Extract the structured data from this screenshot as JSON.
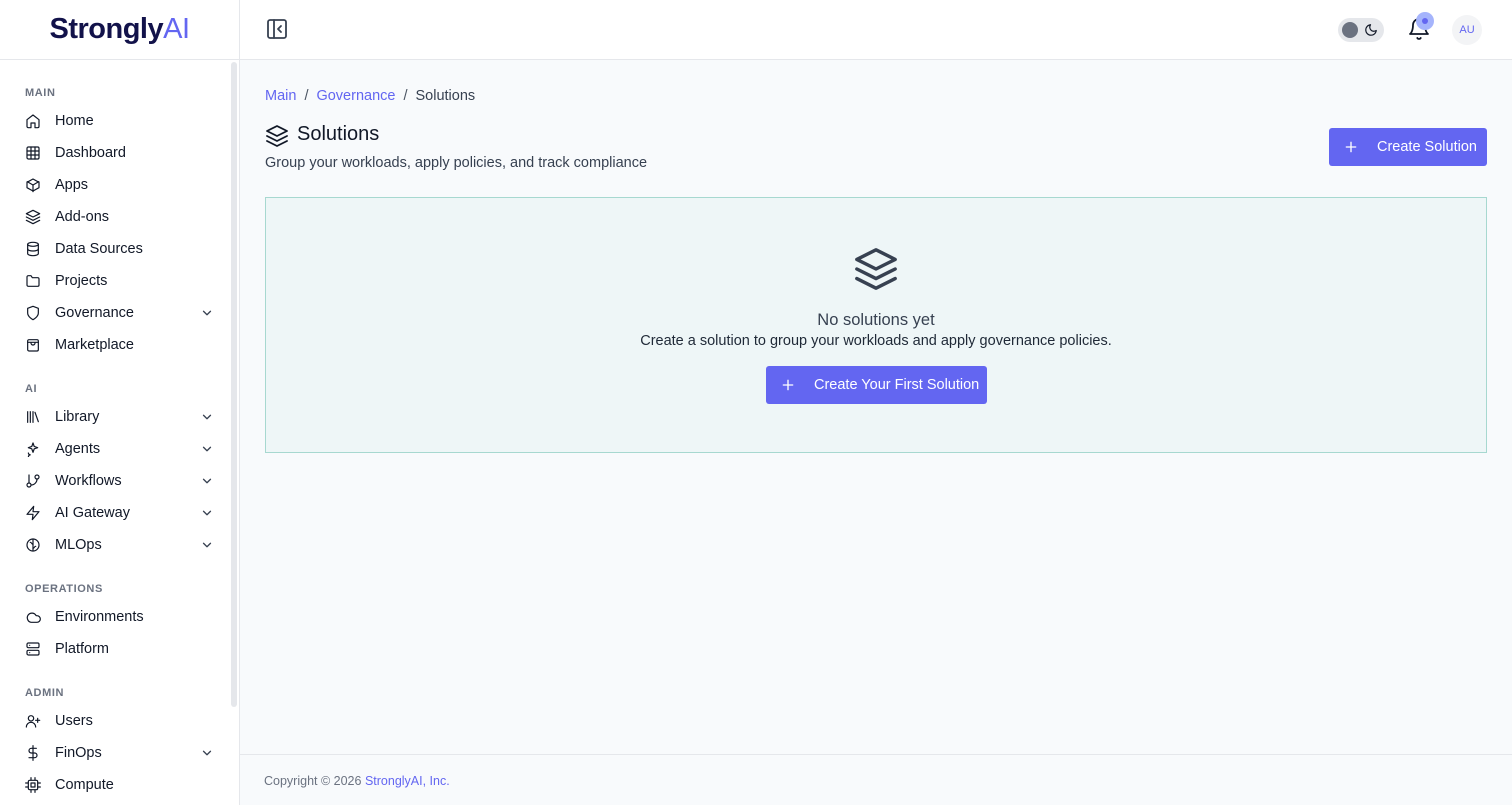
{
  "brand": {
    "name_bold": "Strongly",
    "name_light": "AI"
  },
  "sidebar": {
    "sections": [
      {
        "label": "MAIN",
        "items": [
          {
            "label": "Home",
            "icon": "home-icon",
            "chevron": false
          },
          {
            "label": "Dashboard",
            "icon": "grid-icon",
            "chevron": false
          },
          {
            "label": "Apps",
            "icon": "box-icon",
            "chevron": false
          },
          {
            "label": "Add-ons",
            "icon": "layers-icon",
            "chevron": false
          },
          {
            "label": "Data Sources",
            "icon": "database-icon",
            "chevron": false
          },
          {
            "label": "Projects",
            "icon": "folder-icon",
            "chevron": false
          },
          {
            "label": "Governance",
            "icon": "shield-icon",
            "chevron": true
          },
          {
            "label": "Marketplace",
            "icon": "shopping-bag-icon",
            "chevron": false
          }
        ]
      },
      {
        "label": "AI",
        "items": [
          {
            "label": "Library",
            "icon": "library-icon",
            "chevron": true
          },
          {
            "label": "Agents",
            "icon": "sparkles-icon",
            "chevron": true
          },
          {
            "label": "Workflows",
            "icon": "git-branch-icon",
            "chevron": true
          },
          {
            "label": "AI Gateway",
            "icon": "zap-icon",
            "chevron": true
          },
          {
            "label": "MLOps",
            "icon": "brain-icon",
            "chevron": true
          }
        ]
      },
      {
        "label": "OPERATIONS",
        "items": [
          {
            "label": "Environments",
            "icon": "cloud-icon",
            "chevron": false
          },
          {
            "label": "Platform",
            "icon": "server-icon",
            "chevron": false
          }
        ]
      },
      {
        "label": "ADMIN",
        "items": [
          {
            "label": "Users",
            "icon": "user-plus-icon",
            "chevron": false
          },
          {
            "label": "FinOps",
            "icon": "dollar-icon",
            "chevron": true
          },
          {
            "label": "Compute",
            "icon": "cpu-icon",
            "chevron": false
          }
        ]
      }
    ]
  },
  "header": {
    "avatar_initials": "AU"
  },
  "breadcrumb": {
    "items": [
      "Main",
      "Governance"
    ],
    "current": "Solutions",
    "separator": "/"
  },
  "page": {
    "title": "Solutions",
    "subtitle": "Group your workloads, apply policies, and track compliance",
    "create_button": "Create Solution"
  },
  "empty_state": {
    "title": "No solutions yet",
    "description": "Create a solution to group your workloads and apply governance policies.",
    "button": "Create Your First Solution"
  },
  "footer": {
    "prefix": "Copyright © 2026 ",
    "company": "StronglyAI, Inc."
  },
  "colors": {
    "accent": "#6366f1",
    "brand_dark": "#12124a",
    "panel_bg": "#eef6f7",
    "panel_border": "#a7d8d0"
  }
}
